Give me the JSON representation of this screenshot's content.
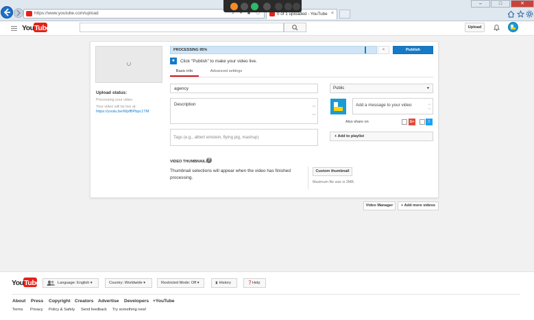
{
  "browser": {
    "url": "https://www.youtube.com/upload",
    "tab_title": "0 of 1 uploaded - YouTube",
    "tab_close": "×",
    "address_icons": "⌕ ▾ ■ ↻",
    "window_controls": [
      "–",
      "□",
      "✕"
    ]
  },
  "header": {
    "logo_text": "YouTube",
    "search_placeholder": "",
    "upload_label": "Upload"
  },
  "upload": {
    "status_label": "Upload status:",
    "processing_text": "Processing your video.",
    "live_text": "Your video will be live at:",
    "video_link": "https://youtu.be/WpfBPbpc1TM",
    "progress_text": "PROCESSING 95%",
    "progress_value": 0.95,
    "close_label": "×",
    "publish_label": "Publish",
    "publish_hint": "Click \"Publish\" to make your video live."
  },
  "tabs": [
    {
      "label": "Basic info",
      "active": true
    },
    {
      "label": "Advanced settings",
      "active": false
    }
  ],
  "form": {
    "title_value": "agency",
    "description_value": "Description",
    "tags_placeholder": "Tags (e.g., albert einstein, flying pig, mashup)",
    "privacy_value": "Public",
    "message_placeholder": "Add a message to your video",
    "also_share_label": "Also share on",
    "gplus_label": "G+",
    "twitter_label": "t",
    "playlist_label": "+ Add to playlist"
  },
  "thumbnails": {
    "section_label": "VIDEO THUMBNAILS",
    "help_label": "?",
    "message": "Thumbnail selections will appear when the video has finished processing.",
    "custom_button": "Custom thumbnail",
    "max_size": "Maximum file size is 2MB."
  },
  "actions": {
    "video_manager": "Video Manager",
    "add_more": "+ Add more videos"
  },
  "footer": {
    "logo_text": "YouTube",
    "language": "Language: English ▾",
    "country": "Country: Worldwide ▾",
    "restricted": "Restricted Mode: Off ▾",
    "history": "History",
    "help": "Help",
    "links1": [
      "About",
      "Press",
      "Copyright",
      "Creators",
      "Advertise",
      "Developers",
      "+YouTube"
    ],
    "links2": [
      "Terms",
      "Privacy",
      "Policy & Safety",
      "Send feedback",
      "Try something new!"
    ]
  },
  "colors": {
    "brand_red": "#e62117",
    "accent_blue": "#167ac6",
    "progress_bg": "#cfe5f7"
  }
}
